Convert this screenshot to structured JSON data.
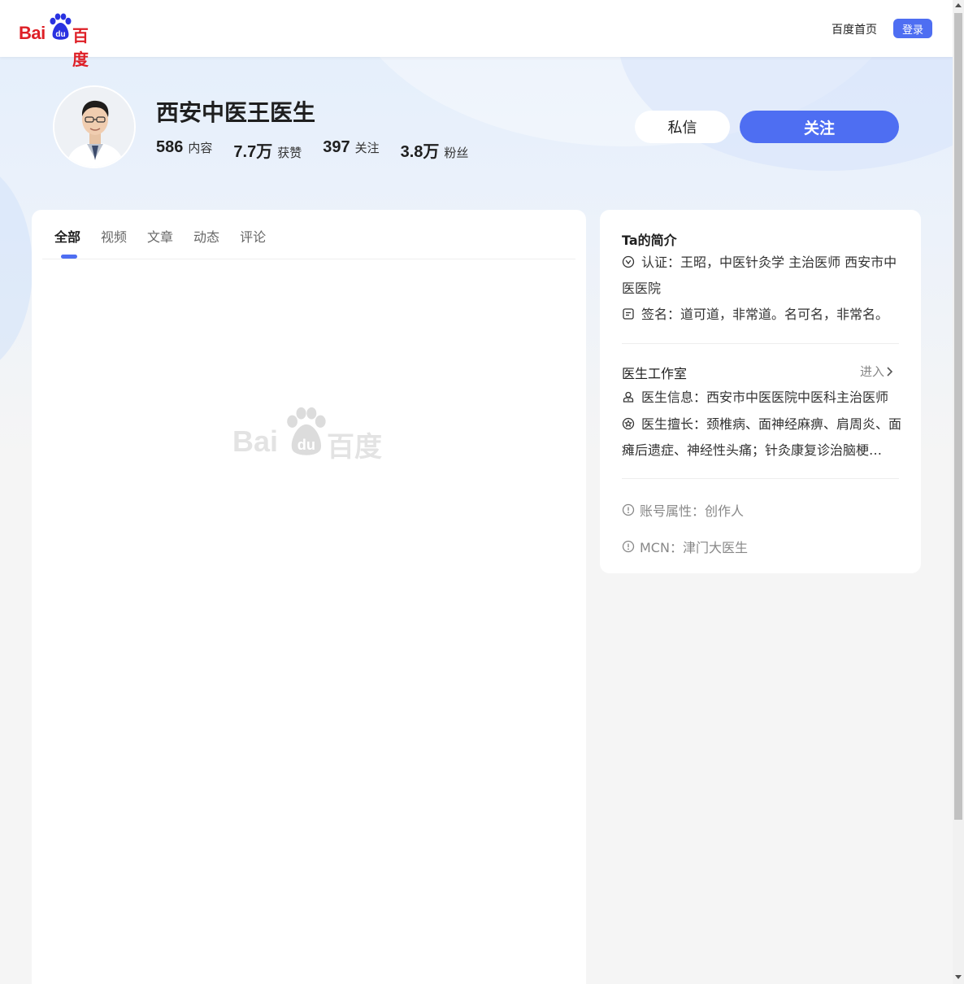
{
  "header": {
    "logo_bai": "Bai",
    "logo_du": "du",
    "logo_cn": "百度",
    "home_link": "百度首页",
    "login_label": "登录"
  },
  "profile": {
    "name": "西安中医王医生",
    "stats": [
      {
        "num": "586",
        "label": "内容"
      },
      {
        "num": "7.7万",
        "label": "获赞"
      },
      {
        "num": "397",
        "label": "关注"
      },
      {
        "num": "3.8万",
        "label": "粉丝"
      }
    ],
    "message_label": "私信",
    "follow_label": "关注"
  },
  "tabs": [
    {
      "label": "全部",
      "active": true
    },
    {
      "label": "视频"
    },
    {
      "label": "文章"
    },
    {
      "label": "动态"
    },
    {
      "label": "评论"
    }
  ],
  "watermark": {
    "bai": "Bai",
    "du": "du",
    "cn": "百度"
  },
  "intro": {
    "title": "Ta的简介",
    "certification": "认证：王昭，中医针灸学 主治医师 西安市中医医院",
    "signature": "签名：道可道，非常道。名可名，非常名。"
  },
  "studio": {
    "title": "医生工作室",
    "enter_label": "进入",
    "doctor_info": "医生信息：西安市中医医院中医科主治医师",
    "expertise": "医生擅长：颈椎病、面神经麻痹、肩周炎、面瘫后遗症、神经性头痛；针灸康复诊治脑梗…"
  },
  "account": {
    "attribute": "账号属性：创作人",
    "mcn": "MCN：津门大医生"
  },
  "colors": {
    "accent": "#4e6ef2",
    "brand_red": "#de1f26"
  }
}
